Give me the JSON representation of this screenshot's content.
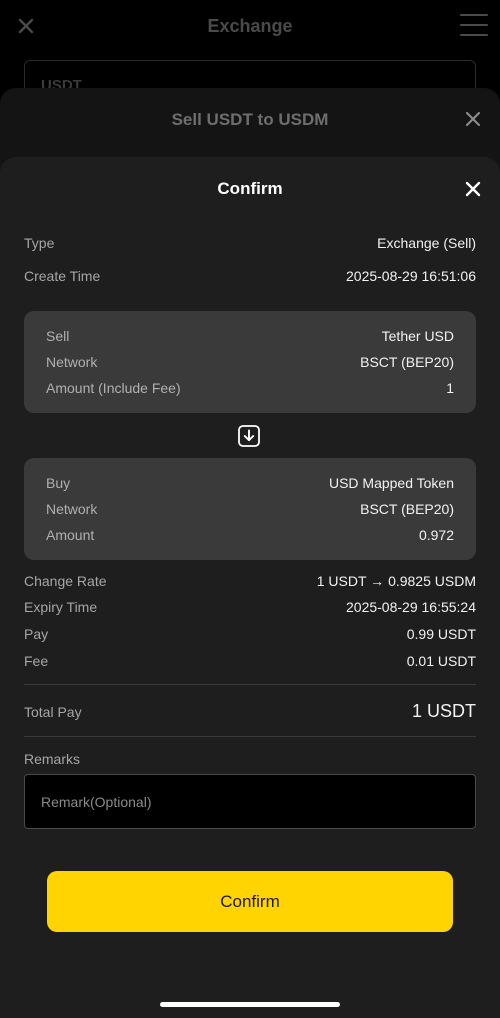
{
  "base": {
    "title": "Exchange",
    "card_label": "USDT"
  },
  "sell_sheet": {
    "title": "Sell USDT to USDM"
  },
  "confirm_sheet": {
    "title": "Confirm",
    "type": {
      "label": "Type",
      "value": "Exchange (Sell)"
    },
    "create_time": {
      "label": "Create Time",
      "value": "2025-08-29 16:51:06"
    },
    "sell_box": {
      "rows": [
        {
          "label": "Sell",
          "value": "Tether USD"
        },
        {
          "label": "Network",
          "value": "BSCT (BEP20)"
        },
        {
          "label": "Amount (Include Fee)",
          "value": "1"
        }
      ]
    },
    "buy_box": {
      "rows": [
        {
          "label": "Buy",
          "value": "USD Mapped Token"
        },
        {
          "label": "Network",
          "value": "BSCT (BEP20)"
        },
        {
          "label": "Amount",
          "value": "0.972"
        }
      ]
    },
    "details": [
      {
        "label": "Change Rate",
        "value": "1 USDT → 0.9825 USDM"
      },
      {
        "label": "Expiry Time",
        "value": "2025-08-29 16:55:24"
      },
      {
        "label": "Pay",
        "value": "0.99 USDT"
      },
      {
        "label": "Fee",
        "value": "0.01 USDT"
      }
    ],
    "total_pay": {
      "label": "Total Pay",
      "value": "1 USDT"
    },
    "remarks": {
      "label": "Remarks",
      "placeholder": "Remark(Optional)",
      "value": ""
    },
    "confirm_button": "Confirm"
  },
  "icons": {
    "close": "close-icon",
    "menu": "hamburger-menu-icon",
    "arrow": "arrow-down-box-icon"
  },
  "colors": {
    "accent": "#ffd400",
    "sheet_bg": "#1e1e1e",
    "box_bg": "#3a3a3a"
  }
}
